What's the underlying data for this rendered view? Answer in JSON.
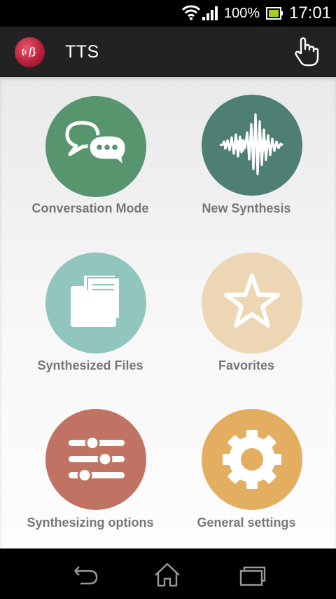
{
  "status_bar": {
    "battery_percent": "100%",
    "time": "17:01",
    "icons": [
      "wifi-icon",
      "signal-icon",
      "battery-icon"
    ]
  },
  "action_bar": {
    "title": "TTS",
    "logo_icon": "tts-logo-icon",
    "action_icon": "hand-pointer-icon"
  },
  "tiles": [
    {
      "label": "Conversation Mode",
      "icon": "chat-bubbles-icon",
      "color": "#56956d"
    },
    {
      "label": "New Synthesis",
      "icon": "waveform-icon",
      "color": "#4e7f72"
    },
    {
      "label": "Synthesized Files",
      "icon": "folder-files-icon",
      "color": "#91c6be"
    },
    {
      "label": "Favorites",
      "icon": "star-icon",
      "color": "#edd6b4"
    },
    {
      "label": "Synthesizing options",
      "icon": "sliders-icon",
      "color": "#c07363"
    },
    {
      "label": "General settings",
      "icon": "gear-icon",
      "color": "#e3ae60"
    }
  ],
  "nav_bar": {
    "items": [
      "back-icon",
      "home-icon",
      "recent-apps-icon"
    ]
  }
}
